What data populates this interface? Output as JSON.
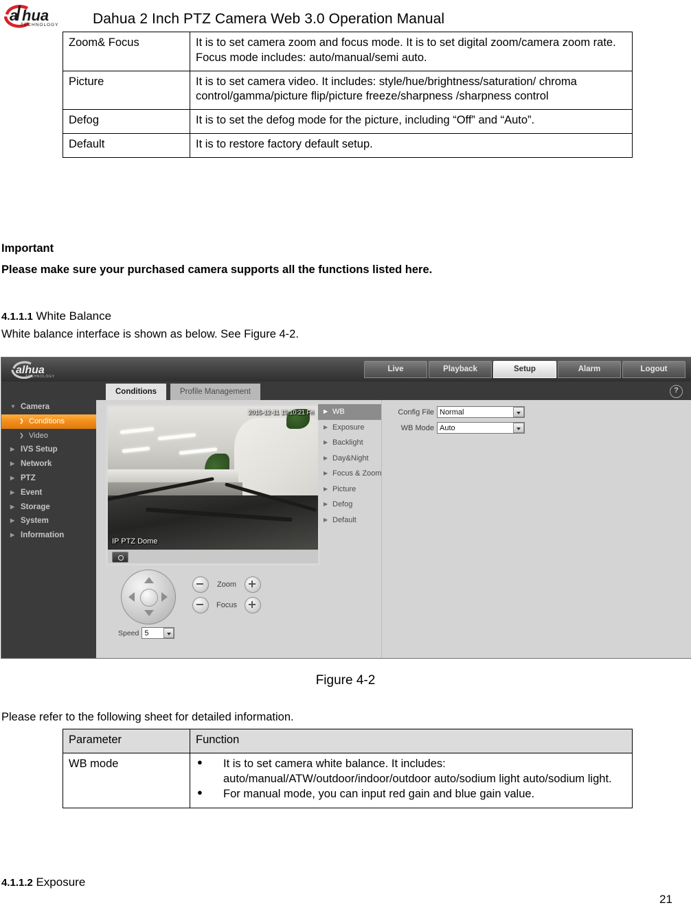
{
  "header": {
    "logo_alt": "dahua-logo",
    "logo_word": "alhua",
    "logo_sub": "TECHNOLOGY",
    "title": "Dahua 2 Inch PTZ Camera Web 3.0 Operation Manual"
  },
  "functions_table": {
    "rows": [
      {
        "parameter": "Zoom& Focus",
        "function": "It is to set camera zoom and focus mode. It is to set digital zoom/camera zoom rate. Focus mode includes: auto/manual/semi auto."
      },
      {
        "parameter": "Picture",
        "function": "It is to set camera video. It includes: style/hue/brightness/saturation/ chroma control/gamma/picture flip/picture freeze/sharpness /sharpness control"
      },
      {
        "parameter": "Defog",
        "function": "It is to set the defog mode for the picture, including “Off” and “Auto”."
      },
      {
        "parameter": "Default",
        "function": "It is to restore factory default setup."
      }
    ]
  },
  "body": {
    "important_label": "Important",
    "important_text": "Please make sure your purchased camera supports all the functions listed here.",
    "heading_411_num": "4.1.1.1",
    "heading_411_text": "White Balance",
    "wb_intro": "White balance interface is shown as below. See Figure 4-2.",
    "figure_caption": "Figure 4-2",
    "refer_text": "Please refer to the following sheet for detailed information.",
    "heading_412_num": "4.1.1.2",
    "heading_412_text": "Exposure",
    "page_number": "21"
  },
  "parameters_table": {
    "header": {
      "col1": "Parameter",
      "col2": "Function"
    },
    "rows": [
      {
        "parameter": "WB mode",
        "bullets": [
          "It is to set camera white balance. It includes: auto/manual/ATW/outdoor/indoor/outdoor auto/sodium light auto/sodium light.",
          "For manual mode, you can input red gain and blue gain value."
        ]
      }
    ]
  },
  "webui": {
    "logo_word": "alhua",
    "logo_sub": "TECHNOLOGY",
    "nav": [
      {
        "label": "Live",
        "active": false
      },
      {
        "label": "Playback",
        "active": false
      },
      {
        "label": "Setup",
        "active": true
      },
      {
        "label": "Alarm",
        "active": false
      },
      {
        "label": "Logout",
        "active": false
      }
    ],
    "tabs": [
      {
        "label": "Conditions",
        "active": true
      },
      {
        "label": "Profile Management",
        "active": false
      }
    ],
    "help_glyph": "?",
    "sidebar": [
      {
        "label": "Camera",
        "level": "top",
        "caret": "▼",
        "selected": false
      },
      {
        "label": "Conditions",
        "level": "sub",
        "caret": "❯",
        "selected": true
      },
      {
        "label": "Video",
        "level": "sub",
        "caret": "❯",
        "selected": false
      },
      {
        "label": "IVS Setup",
        "level": "top",
        "caret": "▶",
        "selected": false
      },
      {
        "label": "Network",
        "level": "top",
        "caret": "▶",
        "selected": false
      },
      {
        "label": "PTZ",
        "level": "top",
        "caret": "▶",
        "selected": false
      },
      {
        "label": "Event",
        "level": "top",
        "caret": "▶",
        "selected": false
      },
      {
        "label": "Storage",
        "level": "top",
        "caret": "▶",
        "selected": false
      },
      {
        "label": "System",
        "level": "top",
        "caret": "▶",
        "selected": false
      },
      {
        "label": "Information",
        "level": "top",
        "caret": "▶",
        "selected": false
      }
    ],
    "submenu": [
      {
        "label": "WB",
        "active": true
      },
      {
        "label": "Exposure",
        "active": false
      },
      {
        "label": "Backlight",
        "active": false
      },
      {
        "label": "Day&Night",
        "active": false
      },
      {
        "label": "Focus & Zoom",
        "active": false
      },
      {
        "label": "Picture",
        "active": false
      },
      {
        "label": "Defog",
        "active": false
      },
      {
        "label": "Default",
        "active": false
      }
    ],
    "video": {
      "timestamp": "2015-12-11 19:10:21 Fri",
      "channel_label": "IP PTZ Dome"
    },
    "fields": {
      "config_file_label": "Config File",
      "config_file_value": "Normal",
      "wb_mode_label": "WB Mode",
      "wb_mode_value": "Auto"
    },
    "ptz": {
      "zoom_label": "Zoom",
      "focus_label": "Focus",
      "speed_label": "Speed",
      "speed_value": "5"
    },
    "colors": {
      "accent_orange": "#f28c1b",
      "topbar_dark": "#444444",
      "panel_gray": "#d4d4d4",
      "sidebar_dark": "#3b3b3b"
    }
  }
}
